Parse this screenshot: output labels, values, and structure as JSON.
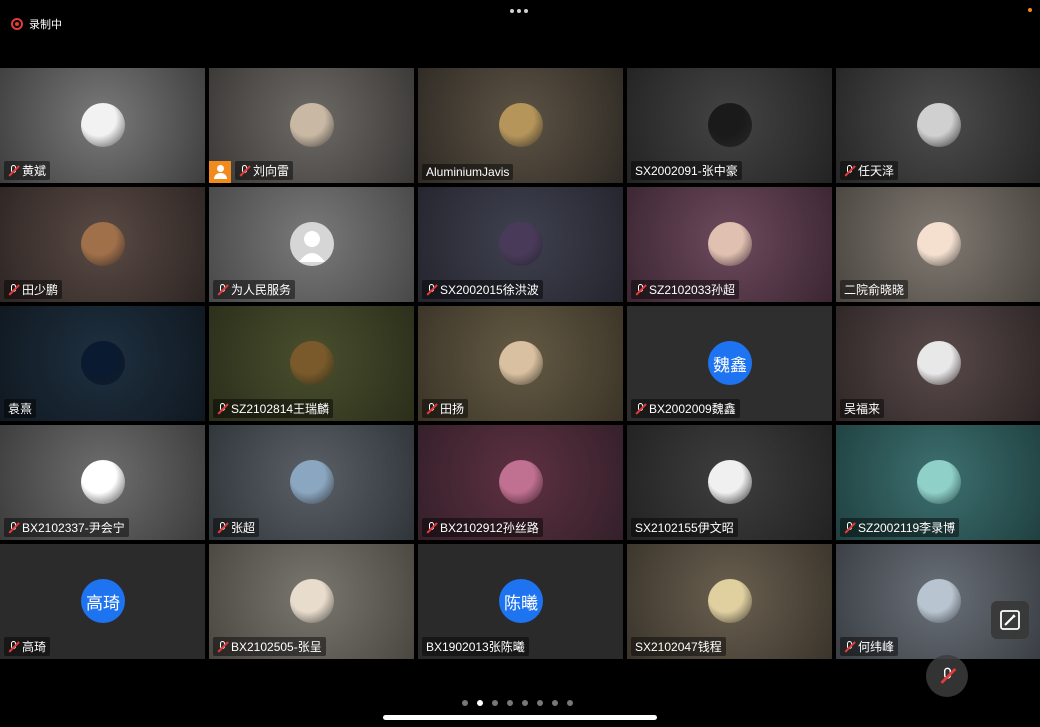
{
  "recording": {
    "label": "录制中",
    "color": "#e23b3b"
  },
  "accent_colors": {
    "host_badge": "#f28b1e",
    "letter_avatar": "#1e73f0",
    "muted": "#e23b3b"
  },
  "participants": [
    {
      "name": "黄斌",
      "muted": true,
      "avatar": "illust-man-icon"
    },
    {
      "name": "刘向雷",
      "muted": true,
      "host": true,
      "avatar": "photo-baby-icon"
    },
    {
      "name": "AluminiumJavis",
      "muted": false,
      "avatar": "photo-old-man-icon"
    },
    {
      "name": "SX2002091-张中豪",
      "muted": false,
      "avatar": "photo-dark-icon"
    },
    {
      "name": "任天泽",
      "muted": true,
      "avatar": "photo-portrait-icon"
    },
    {
      "name": "田少鹏",
      "muted": true,
      "avatar": "photo-group-icon"
    },
    {
      "name": "为人民服务",
      "muted": true,
      "avatar": "default-avatar-icon"
    },
    {
      "name": "SX2002015徐洪波",
      "muted": true,
      "avatar": "anime-avatar-icon"
    },
    {
      "name": "SZ2102033孙超",
      "muted": true,
      "avatar": "muscle-avatar-icon"
    },
    {
      "name": "二院俞晓晓",
      "muted": false,
      "avatar": "cartoon-girl-icon"
    },
    {
      "name": "袁熹",
      "muted": false,
      "avatar": "night-sky-icon"
    },
    {
      "name": "SZ2102814王瑞麟",
      "muted": true,
      "avatar": "pixel-cat-icon"
    },
    {
      "name": "田扬",
      "muted": true,
      "avatar": "dog-avatar-icon"
    },
    {
      "name": "BX2002009魏鑫",
      "muted": true,
      "avatar_text": "魏鑫"
    },
    {
      "name": "吴福来",
      "muted": false,
      "avatar": "cartoon-diver-icon"
    },
    {
      "name": "BX2102337-尹会宁",
      "muted": true,
      "avatar": "cartoon-face-icon"
    },
    {
      "name": "张超",
      "muted": true,
      "avatar": "beach-photo-icon"
    },
    {
      "name": "BX2102912孙丝路",
      "muted": true,
      "avatar": "anime-character-icon"
    },
    {
      "name": "SX2102155伊文昭",
      "muted": false,
      "avatar": "panda-avatar-icon"
    },
    {
      "name": "SZ2002119李录博",
      "muted": true,
      "avatar": "sea-photo-icon"
    },
    {
      "name": "高琦",
      "muted": true,
      "avatar_text": "高琦"
    },
    {
      "name": "BX2102505-张呈",
      "muted": true,
      "avatar": "sheep-cartoon-icon"
    },
    {
      "name": "BX1902013张陈曦",
      "muted": false,
      "avatar_text": "陈曦"
    },
    {
      "name": "SX2102047钱程",
      "muted": false,
      "avatar": "chick-toy-icon"
    },
    {
      "name": "何纬峰",
      "muted": true,
      "avatar": "building-photo-icon"
    }
  ],
  "pagination": {
    "total": 8,
    "current": 2
  }
}
